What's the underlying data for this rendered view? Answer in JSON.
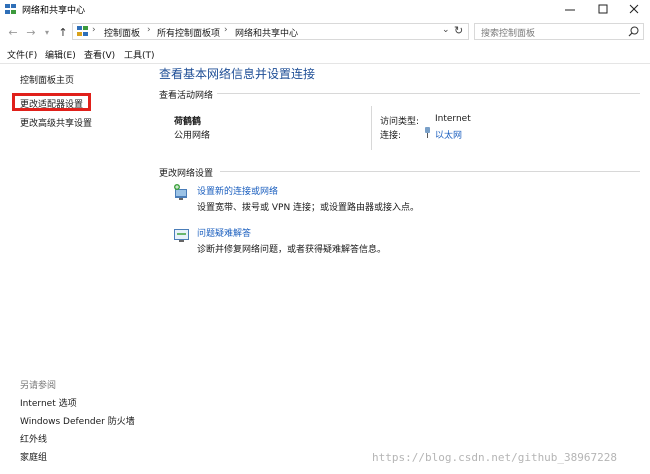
{
  "window": {
    "title": "网络和共享中心"
  },
  "navigation": {
    "breadcrumbs": [
      "控制面板",
      "所有控制面板项",
      "网络和共享中心"
    ],
    "search_placeholder": "搜索控制面板"
  },
  "menu": [
    "文件(F)",
    "编辑(E)",
    "查看(V)",
    "工具(T)"
  ],
  "sidebar": {
    "links": [
      "控制面板主页",
      "更改适配器设置",
      "更改高级共享设置"
    ],
    "see_also_heading": "另请参阅",
    "see_also": [
      "Internet 选项",
      "Windows Defender 防火墙",
      "红外线",
      "家庭组"
    ]
  },
  "main": {
    "title": "查看基本网络信息并设置连接",
    "active_networks_heading": "查看活动网络",
    "network": {
      "name": "荷鹤鹤",
      "type": "公用网络",
      "access_type_label": "访问类型:",
      "access_type_value": "Internet",
      "connection_label": "连接:",
      "connection_value": "以太网"
    },
    "change_settings_heading": "更改网络设置",
    "tasks": [
      {
        "title": "设置新的连接或网络",
        "description": "设置宽带、拨号或 VPN 连接；或设置路由器或接入点。"
      },
      {
        "title": "问题疑难解答",
        "description": "诊断并修复网络问题，或者获得疑难解答信息。"
      }
    ]
  },
  "watermark": "https://blog.csdn.net/github_38967228",
  "colors": {
    "link": "#1b5fbf",
    "title": "#1e4e96",
    "highlight": "#e0201a"
  }
}
